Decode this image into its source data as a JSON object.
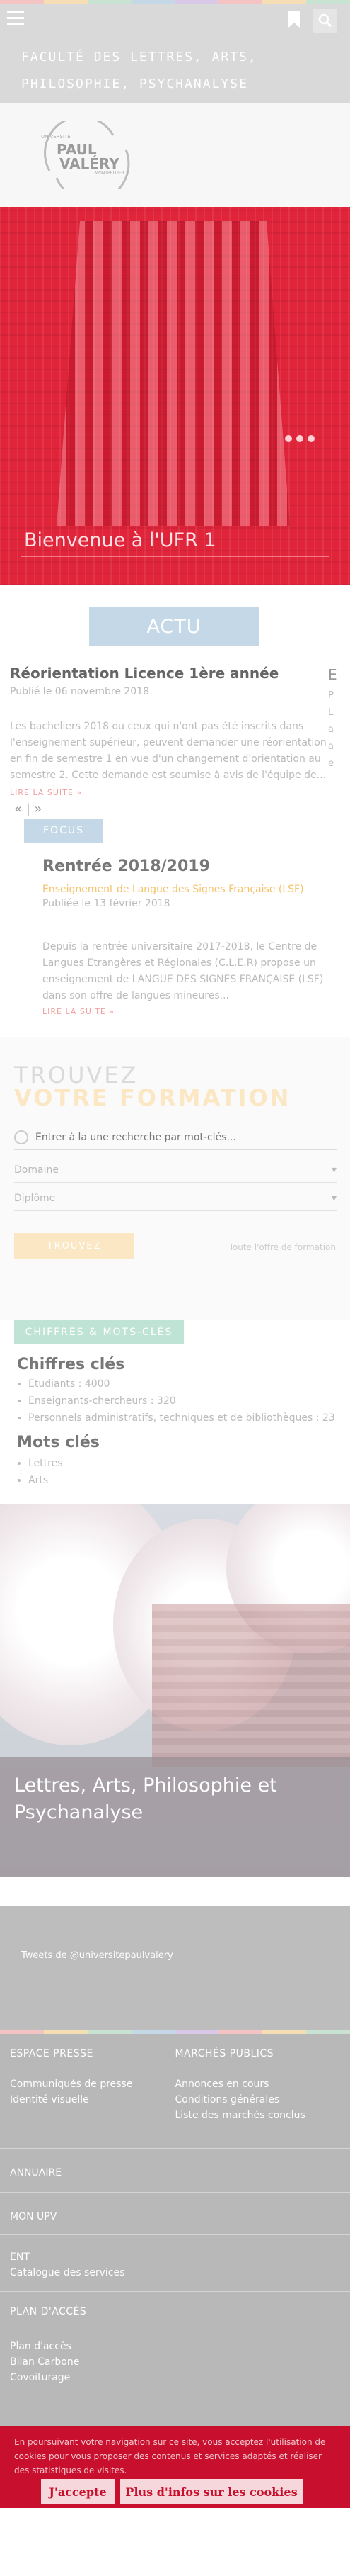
{
  "header": {
    "rainbow_colors": [
      "#f4c3c3",
      "#f5deb3",
      "#c9e3d2",
      "#c4d8e8",
      "#d9c8e8",
      "#f4c3c3",
      "#f5deb3",
      "#c9e3d2"
    ],
    "faculty_title": "FACULTÉ DES LETTRES, ARTS, PHILOSOPHIE, PSYCHANALYSE",
    "icons": [
      "menu-icon",
      "bookmark-icon",
      "search-icon"
    ]
  },
  "logo": {
    "top": "UNIVERSITÉ",
    "main_1": "PAUL",
    "main_2": "VALÉRY",
    "sub": "MONTPELLIER 3"
  },
  "hero": {
    "caption": "Bienvenue à l'UFR 1"
  },
  "actu": {
    "button": "ACTU",
    "item": {
      "title": "Réorientation Licence 1ère année",
      "date": "Publié le 06 novembre 2018",
      "text": "Les bacheliers 2018 ou ceux qui n'ont pas été inscrits dans l'enseignement supérieur, peuvent demander une réorientation en fin de semestre 1 en vue d'un changement d'orientation au semestre 2. Cette demande est soumise à avis de l'équipe de...",
      "more": "LIRE LA SUITE »"
    },
    "next_peek": {
      "title": "E",
      "lines": [
        "P",
        "L",
        "a",
        "a",
        "e"
      ]
    },
    "pager": "«  |  »"
  },
  "focus": {
    "tag": "FOCUS",
    "title": "Rentrée 2018/2019",
    "subtitle": "Enseignement de Langue des Signes Française (LSF)",
    "date": "Publiée le 13 février 2018",
    "text": "Depuis la rentrée universitaire 2017-2018, le Centre de Langues Etrangères et Régionales (C.L.E.R) propose un enseignement de LANGUE DES SIGNES FRANÇAISE (LSF) dans son offre de langues mineures...",
    "more": "LIRE LA SUITE »"
  },
  "trouvez": {
    "line1": "TROUVEZ",
    "line2": "VOTRE FORMATION",
    "search_placeholder": "Entrer à la une recherche par mot-clés...",
    "select1": "Domaine",
    "select2": "Diplôme",
    "button": "TROUVEZ",
    "offre_link": "Toute l'offre de formation"
  },
  "chiffres": {
    "tag": "CHIFFRES & MOTS-CLÉS",
    "title1": "Chiffres clés",
    "items1": [
      "Etudiants : 4000",
      "Enseignants-chercheurs : 320",
      "Personnels administratifs, techniques et de bibliothèques : 23"
    ],
    "title2": "Mots clés",
    "items2": [
      "Lettres",
      "Arts"
    ]
  },
  "photo": {
    "title": "Lettres, Arts, Philosophie et Psychanalyse"
  },
  "twitter": {
    "text": "Tweets de @universitepaulvalery"
  },
  "footer": {
    "col1_title": "ESPACE PRESSE",
    "col1_links": [
      "Communiqués de presse",
      "Identité visuelle"
    ],
    "col2_title": "MARCHÉS PUBLICS",
    "col2_links": [
      "Annonces en cours",
      "Conditions générales",
      "Liste des marchés conclus"
    ],
    "annuaire": "ANNUAIRE",
    "monupv": "MON UPV",
    "ent_links": [
      "ENT",
      "Catalogue des services"
    ],
    "plan_title": "PLAN D'ACCÈS",
    "plan_links": [
      "Plan d'accès",
      "Bilan Carbone",
      "Covoiturage"
    ]
  },
  "cookie": {
    "text": "En poursuivant votre navigation sur ce site, vous acceptez l'utilisation de cookies pour vous proposer des contenus et services adaptés et réaliser des statistiques de visites.",
    "accept": "J'accepte",
    "info": "Plus d'infos sur les cookies"
  }
}
